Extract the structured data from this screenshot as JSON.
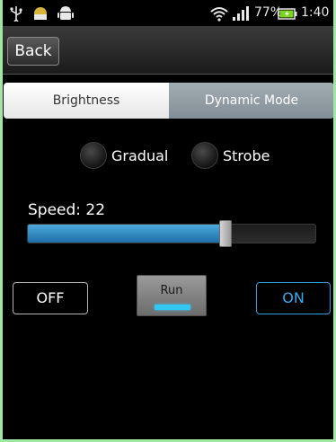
{
  "status_bar": {
    "battery_percent": "77%",
    "time": "1:40",
    "icons": [
      "usb-icon",
      "notification-icon",
      "android-icon",
      "wifi-icon",
      "signal-icon",
      "battery-icon"
    ]
  },
  "titlebar": {
    "back_label": "Back"
  },
  "tabs": [
    {
      "label": "Brightness",
      "selected": true
    },
    {
      "label": "Dynamic Mode",
      "selected": false
    }
  ],
  "mode": {
    "options": [
      {
        "label": "Gradual",
        "checked": false
      },
      {
        "label": "Strobe",
        "checked": false
      }
    ]
  },
  "speed": {
    "label": "Speed: 22",
    "value": 22,
    "max": 32
  },
  "buttons": {
    "off_label": "OFF",
    "run_label": "Run",
    "on_label": "ON"
  },
  "colors": {
    "accent": "#2f9ee3",
    "slider_fill": "#2b8ac6",
    "run_indicator": "#33c8f2",
    "frame": "#9ee8a4"
  }
}
